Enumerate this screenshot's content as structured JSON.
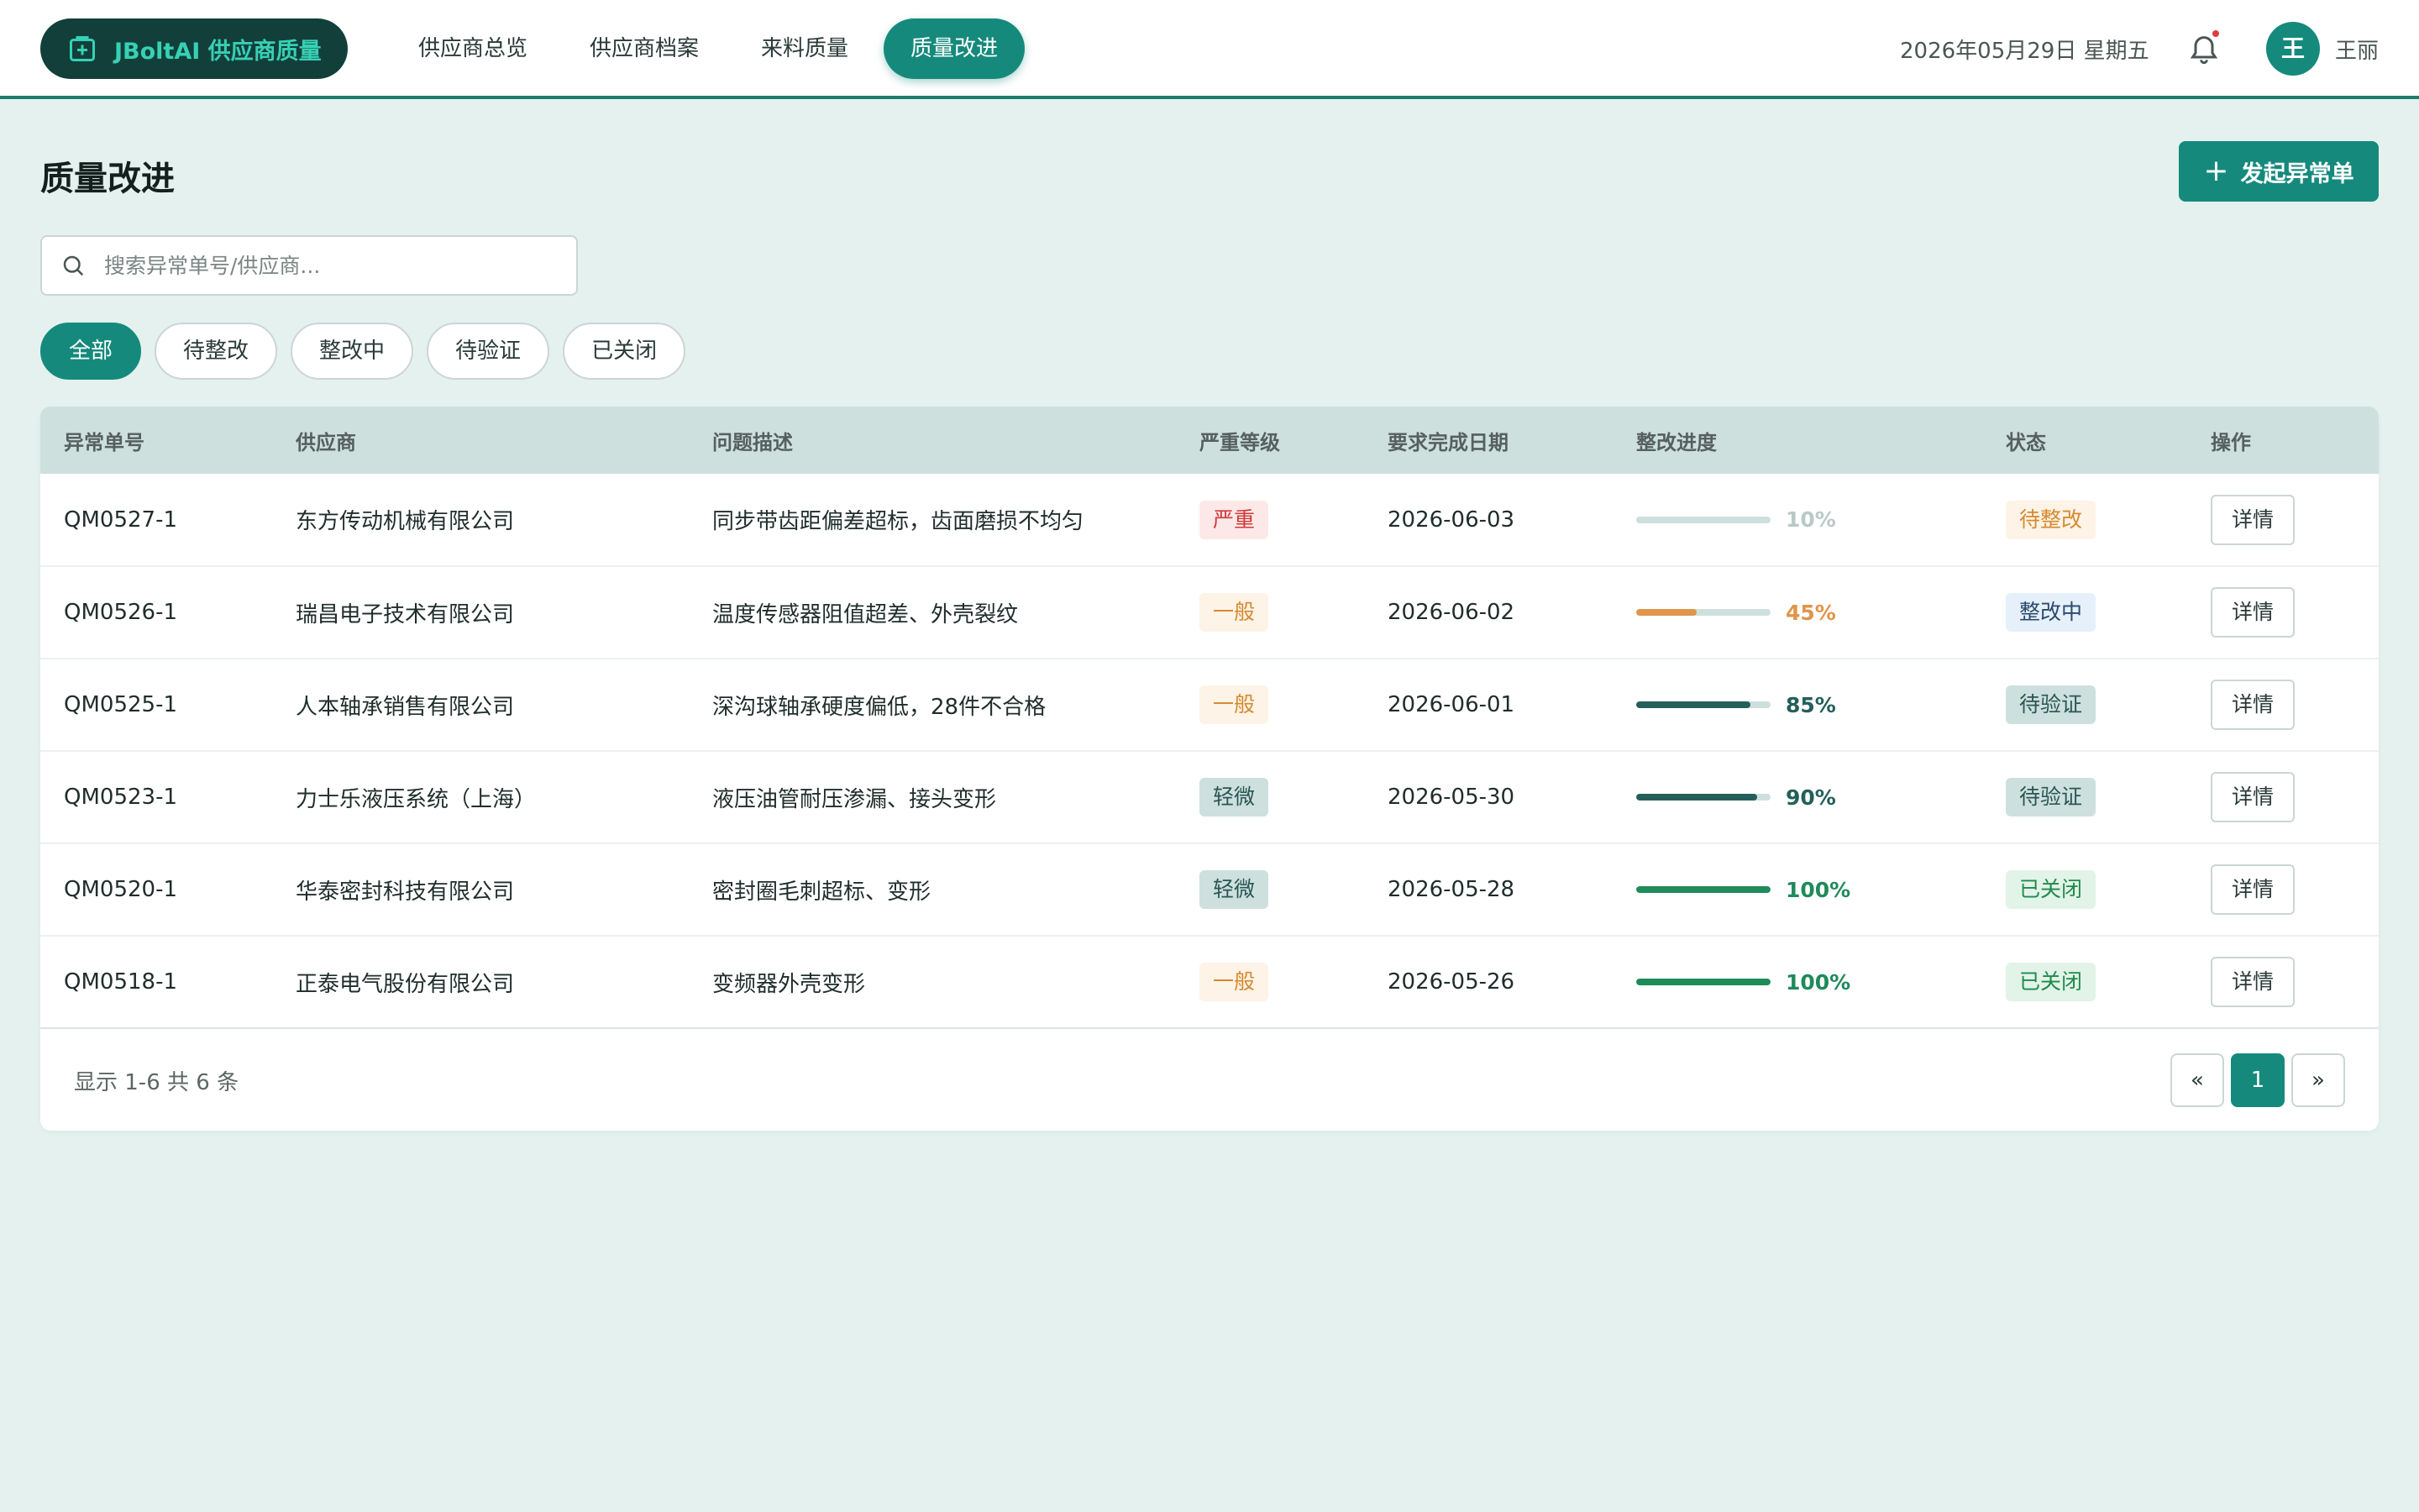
{
  "app": {
    "brand": "JBoltAI 供应商质量"
  },
  "nav": {
    "items": [
      {
        "label": "供应商总览",
        "active": false
      },
      {
        "label": "供应商档案",
        "active": false
      },
      {
        "label": "来料质量",
        "active": false
      },
      {
        "label": "质量改进",
        "active": true
      }
    ]
  },
  "header": {
    "date": "2026年05月29日 星期五",
    "avatar_initial": "王",
    "username": "王丽"
  },
  "page": {
    "title": "质量改进",
    "new_button": "发起异常单",
    "search_placeholder": "搜索异常单号/供应商...",
    "filters": [
      {
        "label": "全部",
        "active": true
      },
      {
        "label": "待整改",
        "active": false
      },
      {
        "label": "整改中",
        "active": false
      },
      {
        "label": "待验证",
        "active": false
      },
      {
        "label": "已关闭",
        "active": false
      }
    ]
  },
  "table": {
    "columns": [
      "异常单号",
      "供应商",
      "问题描述",
      "严重等级",
      "要求完成日期",
      "整改进度",
      "状态",
      "操作"
    ],
    "rows": [
      {
        "id": "QM0527-1",
        "supplier": "东方传动机械有限公司",
        "issue": "同步带齿距偏差超标，齿面磨损不均匀",
        "severity": "严重",
        "due": "2026-06-03",
        "progress": 10,
        "progress_label": "10%",
        "progress_color": "#cde0de",
        "progress_text_color": "#b9c9c7",
        "status": "待整改",
        "action": "详情"
      },
      {
        "id": "QM0526-1",
        "supplier": "瑞昌电子技术有限公司",
        "issue": "温度传感器阻值超差、外壳裂纹",
        "severity": "一般",
        "due": "2026-06-02",
        "progress": 45,
        "progress_label": "45%",
        "progress_color": "#e0954a",
        "progress_text_color": "#e0954a",
        "status": "整改中",
        "action": "详情"
      },
      {
        "id": "QM0525-1",
        "supplier": "人本轴承销售有限公司",
        "issue": "深沟球轴承硬度偏低，28件不合格",
        "severity": "一般",
        "due": "2026-06-01",
        "progress": 85,
        "progress_label": "85%",
        "progress_color": "#245f5a",
        "progress_text_color": "#245f5a",
        "status": "待验证",
        "action": "详情"
      },
      {
        "id": "QM0523-1",
        "supplier": "力士乐液压系统（上海）",
        "issue": "液压油管耐压渗漏、接头变形",
        "severity": "轻微",
        "due": "2026-05-30",
        "progress": 90,
        "progress_label": "90%",
        "progress_color": "#245f5a",
        "progress_text_color": "#245f5a",
        "status": "待验证",
        "action": "详情"
      },
      {
        "id": "QM0520-1",
        "supplier": "华泰密封科技有限公司",
        "issue": "密封圈毛刺超标、变形",
        "severity": "轻微",
        "due": "2026-05-28",
        "progress": 100,
        "progress_label": "100%",
        "progress_color": "#1f8a5a",
        "progress_text_color": "#1f8a5a",
        "status": "已关闭",
        "action": "详情"
      },
      {
        "id": "QM0518-1",
        "supplier": "正泰电气股份有限公司",
        "issue": "变频器外壳变形",
        "severity": "一般",
        "due": "2026-05-26",
        "progress": 100,
        "progress_label": "100%",
        "progress_color": "#1f8a5a",
        "progress_text_color": "#1f8a5a",
        "status": "已关闭",
        "action": "详情"
      }
    ]
  },
  "pagination": {
    "summary": "显示 1-6 共 6 条",
    "prev": "«",
    "current": "1",
    "next": "»"
  },
  "colors": {
    "accent": "#158a7c",
    "header_border": "#1d7d70",
    "background": "#e4f1ef"
  }
}
